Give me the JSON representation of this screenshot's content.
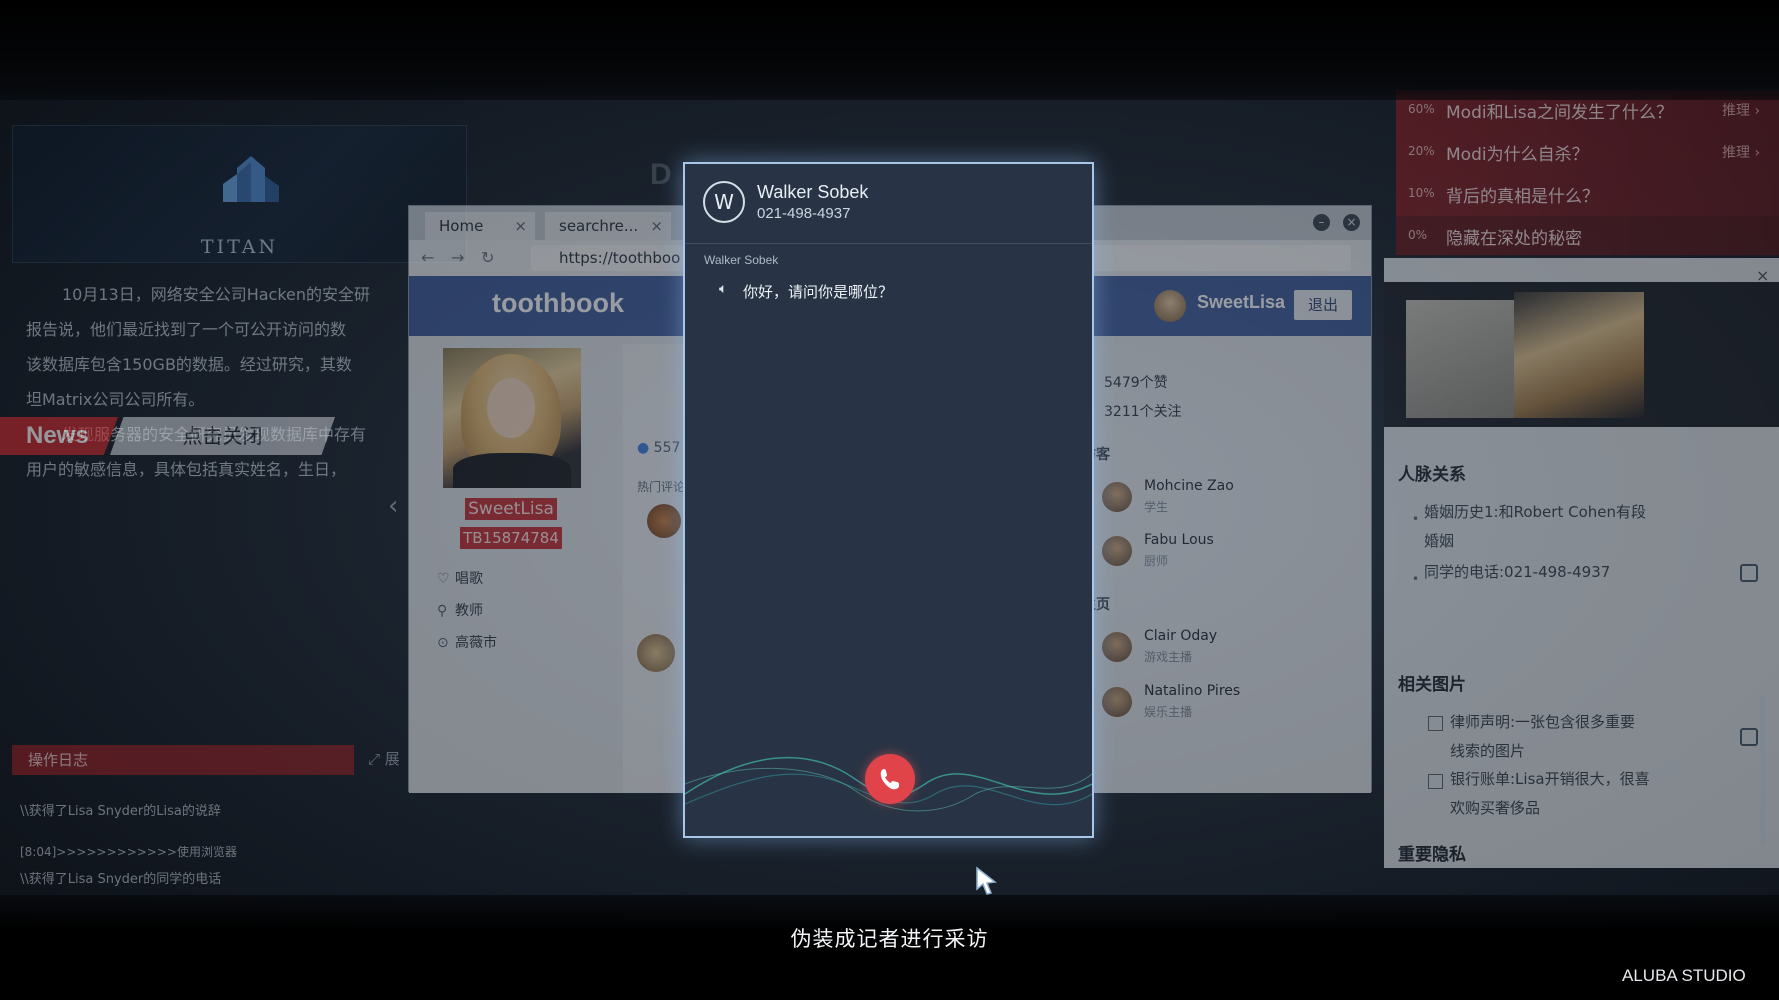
{
  "news": {
    "brand": "TITAN",
    "paragraph1": "10月13日，网络安全公司Hacken的安全研究员报告说，他们最近找到了一个可公开访问的数据库。该数据库包含150GB的数据。经过研究，其数据坦Matrix公司公司所有。",
    "paragraph1_lines": [
      "10月13日，网络安全公司Hacken的安全研",
      "报告说，他们最近找到了一个可公开访问的数",
      "该数据库包含150GB的数据。经过研究，其数",
      "坦Matrix公司公司所有。"
    ],
    "paragraph2_lines": [
      "发现服务器的安全研究员发现数据库中存有",
      "用户的敏感信息，具体包括真实姓名，生日，"
    ],
    "tab_news": "News",
    "tab_close": "点击关闭"
  },
  "log": {
    "title": "操作日志",
    "expand": "展",
    "lines": [
      "\\\\获得了Lisa Snyder的Lisa的说辞",
      "[8:04]>>>>>>>>>>>>使用浏览器",
      "\\\\获得了Lisa Snyder的同学的电话"
    ]
  },
  "browser": {
    "tabs": [
      {
        "label": "Home"
      },
      {
        "label": "searchre..."
      }
    ],
    "url": "https://toothboo",
    "site_name": "toothbook",
    "user": "SweetLisa",
    "logout": "退出",
    "profile": {
      "name": "SweetLisa",
      "id": "TB15874784",
      "attrs": [
        "唱歌",
        "教师",
        "高薇市"
      ]
    },
    "feed": {
      "count": "557",
      "hot_comments": "热门评论"
    },
    "stats": {
      "likes": "5479个赞",
      "follows": "3211个关注"
    },
    "visitors_title": "访客",
    "visitors": [
      {
        "name": "Mohcine Zao",
        "role": "学生"
      },
      {
        "name": "Fabu Lous",
        "role": "厨师"
      }
    ],
    "home_title": "主页",
    "home_people": [
      {
        "name": "Clair Oday",
        "role": "游戏主播"
      },
      {
        "name": "Natalino Pires",
        "role": "娱乐主播"
      }
    ]
  },
  "call": {
    "initial": "W",
    "name": "Walker Sobek",
    "phone": "021-498-4937",
    "message_from": "Walker Sobek",
    "message": "你好，请问你是哪位？",
    "hangup_color": "#e0434a"
  },
  "questions": [
    {
      "pct": "60%",
      "text": "Modi和Lisa之间发生了什么？",
      "more": "推理"
    },
    {
      "pct": "20%",
      "text": "Modi为什么自杀？",
      "more": "推理"
    },
    {
      "pct": "10%",
      "text": "背后的真相是什么？",
      "more": ""
    },
    {
      "pct": "0%",
      "text": "隐藏在深处的秘密",
      "more": ""
    }
  ],
  "dossier": {
    "relations_title": "人脉关系",
    "relations": [
      "婚姻历史1:和Robert Cohen有段",
      "婚姻",
      "同学的电话:021-498-4937"
    ],
    "photos_title": "相关图片",
    "photos": [
      "律师声明:一张包含很多重要",
      "线索的图片",
      "银行账单:Lisa开销很大，很喜",
      "欢购买奢侈品"
    ],
    "privacy_title": "重要隐私"
  },
  "subtitle": "伪装成记者进行采访",
  "studio": "ALUBA STUDIO"
}
